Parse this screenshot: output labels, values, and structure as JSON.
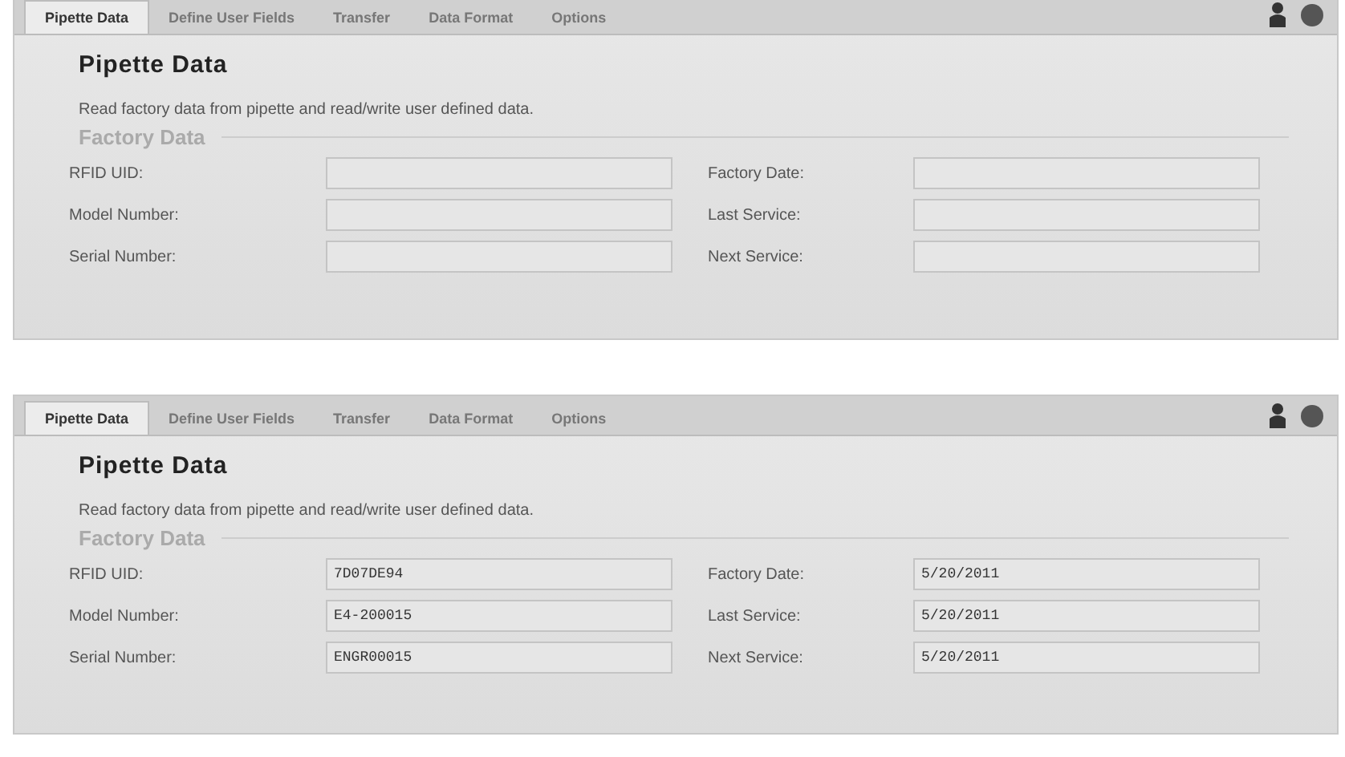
{
  "panels": [
    {
      "tabs": [
        {
          "label": "Pipette Data",
          "selected": true
        },
        {
          "label": "Define User Fields",
          "selected": false
        },
        {
          "label": "Transfer",
          "selected": false
        },
        {
          "label": "Data Format",
          "selected": false
        },
        {
          "label": "Options",
          "selected": false
        }
      ],
      "title": "Pipette Data",
      "description": "Read factory data from pipette and read/write user defined data.",
      "section": "Factory Data",
      "fields": [
        {
          "label": "RFID UID:"
        },
        {
          "label": "Factory Date:"
        },
        {
          "label": "Model Number:"
        },
        {
          "label": "Last Service:"
        },
        {
          "label": "Serial Number:"
        },
        {
          "label": "Next Service:"
        }
      ]
    },
    {
      "tabs": [
        {
          "label": "Pipette Data",
          "selected": true
        },
        {
          "label": "Define User Fields",
          "selected": false
        },
        {
          "label": "Transfer",
          "selected": false
        },
        {
          "label": "Data Format",
          "selected": false
        },
        {
          "label": "Options",
          "selected": false
        }
      ],
      "title": "Pipette Data",
      "description": "Read factory data from pipette and read/write user defined data.",
      "section": "Factory Data",
      "fields": [
        {
          "label": "RFID UID:",
          "value": "7D07DE94"
        },
        {
          "label": "Factory Date:",
          "value": "5/20/2011"
        },
        {
          "label": "Model Number:",
          "value": "E4-200015"
        },
        {
          "label": "Last Service:",
          "value": "5/20/2011"
        },
        {
          "label": "Serial Number:",
          "value": "ENGR00015"
        },
        {
          "label": "Next Service:",
          "value": "5/20/2011"
        }
      ]
    }
  ]
}
